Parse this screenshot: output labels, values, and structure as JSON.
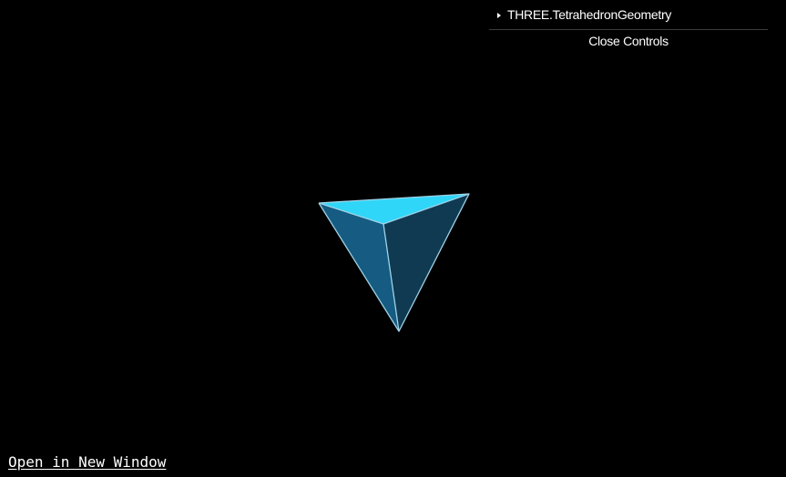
{
  "gui": {
    "folder_label": "THREE.TetrahedronGeometry",
    "close_label": "Close Controls"
  },
  "footer": {
    "open_link": "Open in New Window"
  },
  "scene": {
    "background": "#000000",
    "object": "tetrahedron",
    "colors": {
      "top_face": "#2fd6f7",
      "left_face": "#155b82",
      "right_face": "#0f3a52",
      "edges": "#9fd3e8"
    }
  }
}
